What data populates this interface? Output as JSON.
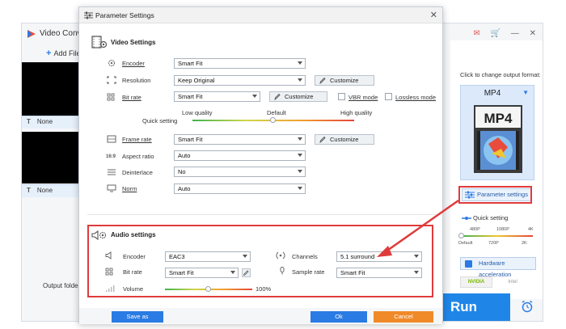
{
  "background_app": {
    "title": "Video Conv",
    "add_file": "Add File",
    "files": [
      {
        "subtitle": "None"
      },
      {
        "subtitle": "None"
      }
    ],
    "output_folder_label": "Output folder:",
    "run_label": "Run"
  },
  "right_panel": {
    "hint": "Click to change output format:",
    "format": "MP4",
    "format_image_text": "MP4",
    "parameter_settings": "Parameter settings",
    "quick_setting": "Quick setting",
    "quick_ticks_top": [
      "480P",
      "1080P",
      "4K"
    ],
    "quick_ticks_bottom": [
      "Default",
      "720P",
      "2K"
    ],
    "hardware_accel": "Hardware acceleration",
    "nvidia": "NVIDIA",
    "intel": "Intel"
  },
  "dialog": {
    "title": "Parameter Settings",
    "video_section": "Video Settings",
    "audio_section": "Audio settings",
    "video": {
      "encoder": {
        "label": "Encoder",
        "value": "Smart Fit"
      },
      "resolution": {
        "label": "Resolution",
        "value": "Keep Original",
        "button": "Customize"
      },
      "bitrate": {
        "label": "Bit rate",
        "value": "Smart Fit",
        "button": "Customize",
        "vbr": "VBR mode",
        "lossless": "Lossless mode"
      },
      "quality": {
        "low": "Low quality",
        "default": "Default",
        "high": "High quality",
        "quick": "Quick setting",
        "level": 0.5
      },
      "frame_rate": {
        "label": "Frame rate",
        "value": "Smart Fit",
        "button": "Customize"
      },
      "aspect_ratio": {
        "label": "Aspect ratio",
        "value": "Auto"
      },
      "deinterlace": {
        "label": "Deinterlace",
        "value": "No"
      },
      "norm": {
        "label": "Norm",
        "value": "Auto"
      }
    },
    "audio": {
      "encoder": {
        "label": "Encoder",
        "value": "EAC3"
      },
      "channels": {
        "label": "Channels",
        "value": "5.1 surround"
      },
      "bitrate": {
        "label": "Bit rate",
        "value": "Smart Fit"
      },
      "sample_rate": {
        "label": "Sample rate",
        "value": "Smart Fit"
      },
      "volume": {
        "label": "Volume",
        "value": "100%",
        "level": 0.5
      }
    },
    "save_as": "Save as",
    "ok": "Ok",
    "cancel": "Cancel"
  },
  "colors": {
    "accent": "#2a7be4",
    "highlight": "#e03b3b",
    "cancel": "#f08a28",
    "run": "#1f86e8"
  }
}
